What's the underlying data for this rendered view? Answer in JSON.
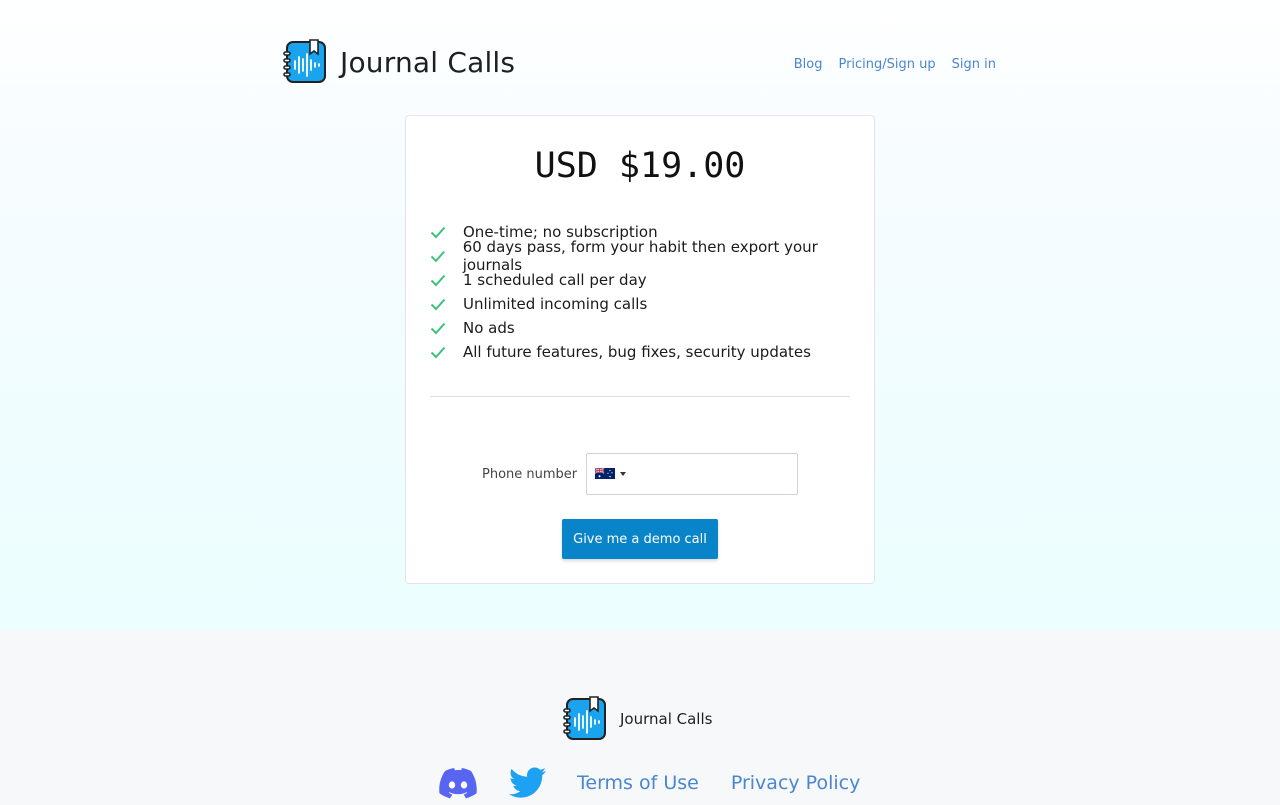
{
  "header": {
    "brand": "Journal Calls",
    "nav": [
      "Blog",
      "Pricing/Sign up",
      "Sign in"
    ]
  },
  "pricing": {
    "price": "USD $19.00",
    "features": [
      "One-time; no subscription",
      "60 days pass, form your habit then export your journals",
      "1 scheduled call per day",
      "Unlimited incoming calls",
      "No ads",
      "All future features, bug fixes, security updates"
    ],
    "phone_label": "Phone number",
    "phone_value": "",
    "country": "AU",
    "button_label": "Give me a demo call"
  },
  "footer": {
    "brand": "Journal Calls",
    "links": [
      "Terms of Use",
      "Privacy Policy"
    ],
    "social": [
      "discord-icon",
      "twitter-icon"
    ]
  },
  "colors": {
    "accent": "#0a84c9",
    "link": "#4a86cf",
    "check": "#3cc27a"
  }
}
